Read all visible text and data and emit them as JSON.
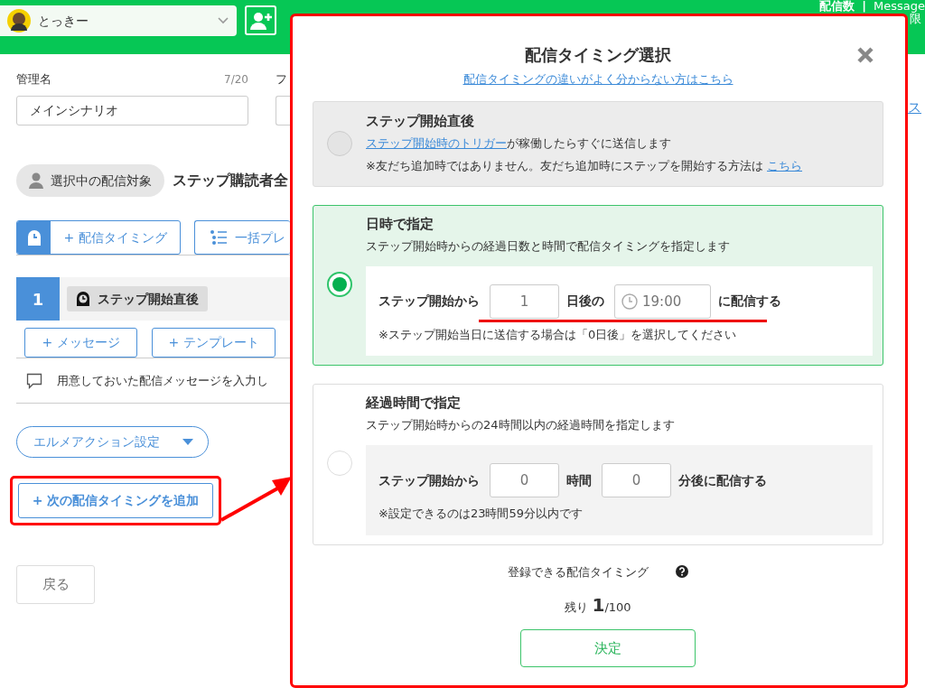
{
  "header": {
    "account": "とっきー",
    "counter_label": "配信数",
    "separator": "|",
    "message_label": "Message",
    "limit_label": "限"
  },
  "form": {
    "name_label": "管理名",
    "name_count": "7/20",
    "name_value": "メインシナリオ",
    "second_label": "フ",
    "side_link": "ス"
  },
  "target": {
    "label": "選択中の配信対象",
    "value": "ステップ購読者全"
  },
  "toolbar": [
    "+ 配信タイミング",
    "一括プレ"
  ],
  "step": {
    "number": "1",
    "timing": "ステップ開始直後",
    "actions": [
      "+ メッセージ",
      "+ テンプレート"
    ],
    "message_hint": "用意しておいた配信メッセージを入力し"
  },
  "action_menu": "エルメアクション設定",
  "add_timing_button": "+ 次の配信タイミングを追加",
  "back_button": "戻る",
  "dialog": {
    "title": "配信タイミング選択",
    "help_link": "配信タイミングの違いがよく分からない方はこちら",
    "options": [
      {
        "kind": "immediate",
        "title": "ステップ開始直後",
        "selected": false,
        "disabled": true,
        "description": {
          "link": "ステップ開始時のトリガー",
          "text": "が稼働したらすぐに送信します"
        },
        "note": {
          "text": "※友だち追加時ではありません。友だち追加時にステップを開始する方法は",
          "link": "こちら"
        }
      },
      {
        "kind": "schedule",
        "title": "日時で指定",
        "selected": true,
        "disabled": false,
        "description": "ステップ開始時からの経過日数と時間で配信タイミングを指定します",
        "fields": [
          {
            "kind": "text",
            "text": "ステップ開始から"
          },
          {
            "kind": "number",
            "placeholder": "1"
          },
          {
            "kind": "text",
            "text": "日後の"
          },
          {
            "kind": "time",
            "placeholder": "19:00"
          },
          {
            "kind": "text",
            "text": "に配信する"
          }
        ],
        "note": "※ステップ開始当日に送信する場合は「0日後」を選択してください"
      },
      {
        "kind": "schedule",
        "title": "経過時間で指定",
        "selected": false,
        "disabled": false,
        "description": "ステップ開始時からの24時間以内の経過時間を指定します",
        "fields": [
          {
            "kind": "text",
            "text": "ステップ開始から"
          },
          {
            "kind": "number",
            "placeholder": "0"
          },
          {
            "kind": "text",
            "text": "時間"
          },
          {
            "kind": "number",
            "placeholder": "0"
          },
          {
            "kind": "text",
            "text": "分後に配信する"
          }
        ],
        "note": "※設定できるのは23時間59分以内です"
      }
    ],
    "remaining_label": "登録できる配信タイミング",
    "remaining_prefix": "残り",
    "remaining_count": "1",
    "remaining_total": "/100",
    "submit": "決定"
  }
}
